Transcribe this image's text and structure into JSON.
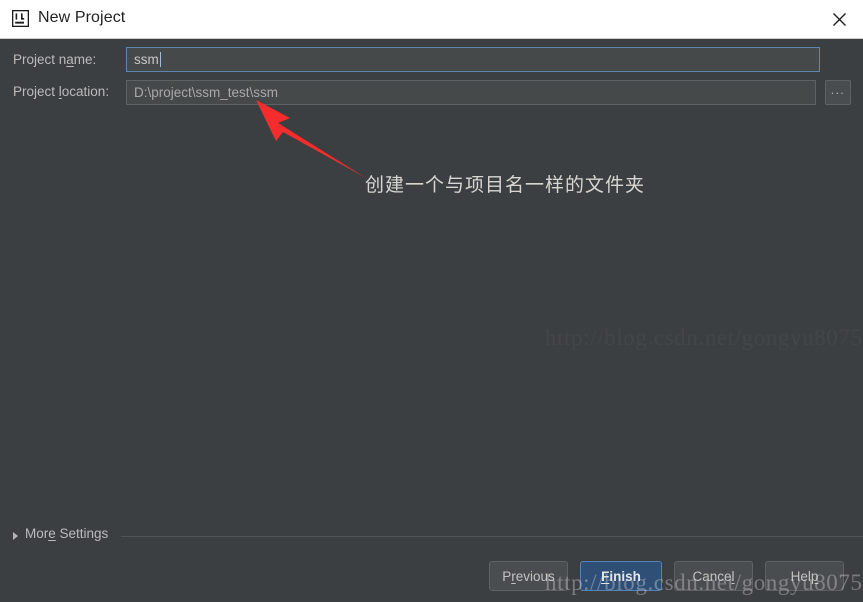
{
  "window": {
    "title": "New Project",
    "app_icon": "intellij-idea-icon",
    "close_icon": "close-icon",
    "titlebar_bg": "#ffffff",
    "body_bg": "#3c3f41"
  },
  "form": {
    "project_name": {
      "label_prefix": "Project n",
      "label_mnemonic": "a",
      "label_suffix": "me:",
      "value": "ssm",
      "placeholder": "",
      "focused": true,
      "focus_border_color": "#5d86b0"
    },
    "project_location": {
      "label_prefix": "Project ",
      "label_mnemonic": "l",
      "label_suffix": "ocation:",
      "value": "D:\\project\\ssm_test\\ssm",
      "placeholder": "",
      "browse_button_label": "...",
      "browse_icon": "ellipsis-icon"
    }
  },
  "annotation": {
    "text": "创建一个与项目名一样的文件夹",
    "arrow_icon": "red-arrow-icon",
    "arrow_color": "#f03030"
  },
  "more_settings": {
    "label_prefix": "Mor",
    "label_mnemonic": "e",
    "label_suffix": " Settings",
    "expanded": false,
    "triangle_icon": "chevron-right-icon"
  },
  "footer": {
    "buttons": [
      {
        "name": "previous",
        "label_prefix": "P",
        "label_mnemonic": "r",
        "label_suffix": "evious",
        "default": false
      },
      {
        "name": "finish",
        "label_prefix": "",
        "label_mnemonic": "F",
        "label_suffix": "inish",
        "default": true
      },
      {
        "name": "cancel",
        "label_prefix": "Cance",
        "label_mnemonic": "l",
        "label_suffix": "",
        "default": false
      },
      {
        "name": "help",
        "label_prefix": "Hel",
        "label_mnemonic": "p",
        "label_suffix": "",
        "default": false
      }
    ],
    "default_button_color": "#2f4f77"
  },
  "watermark": {
    "text": "http://blog.csdn.net/gongyu8075"
  }
}
